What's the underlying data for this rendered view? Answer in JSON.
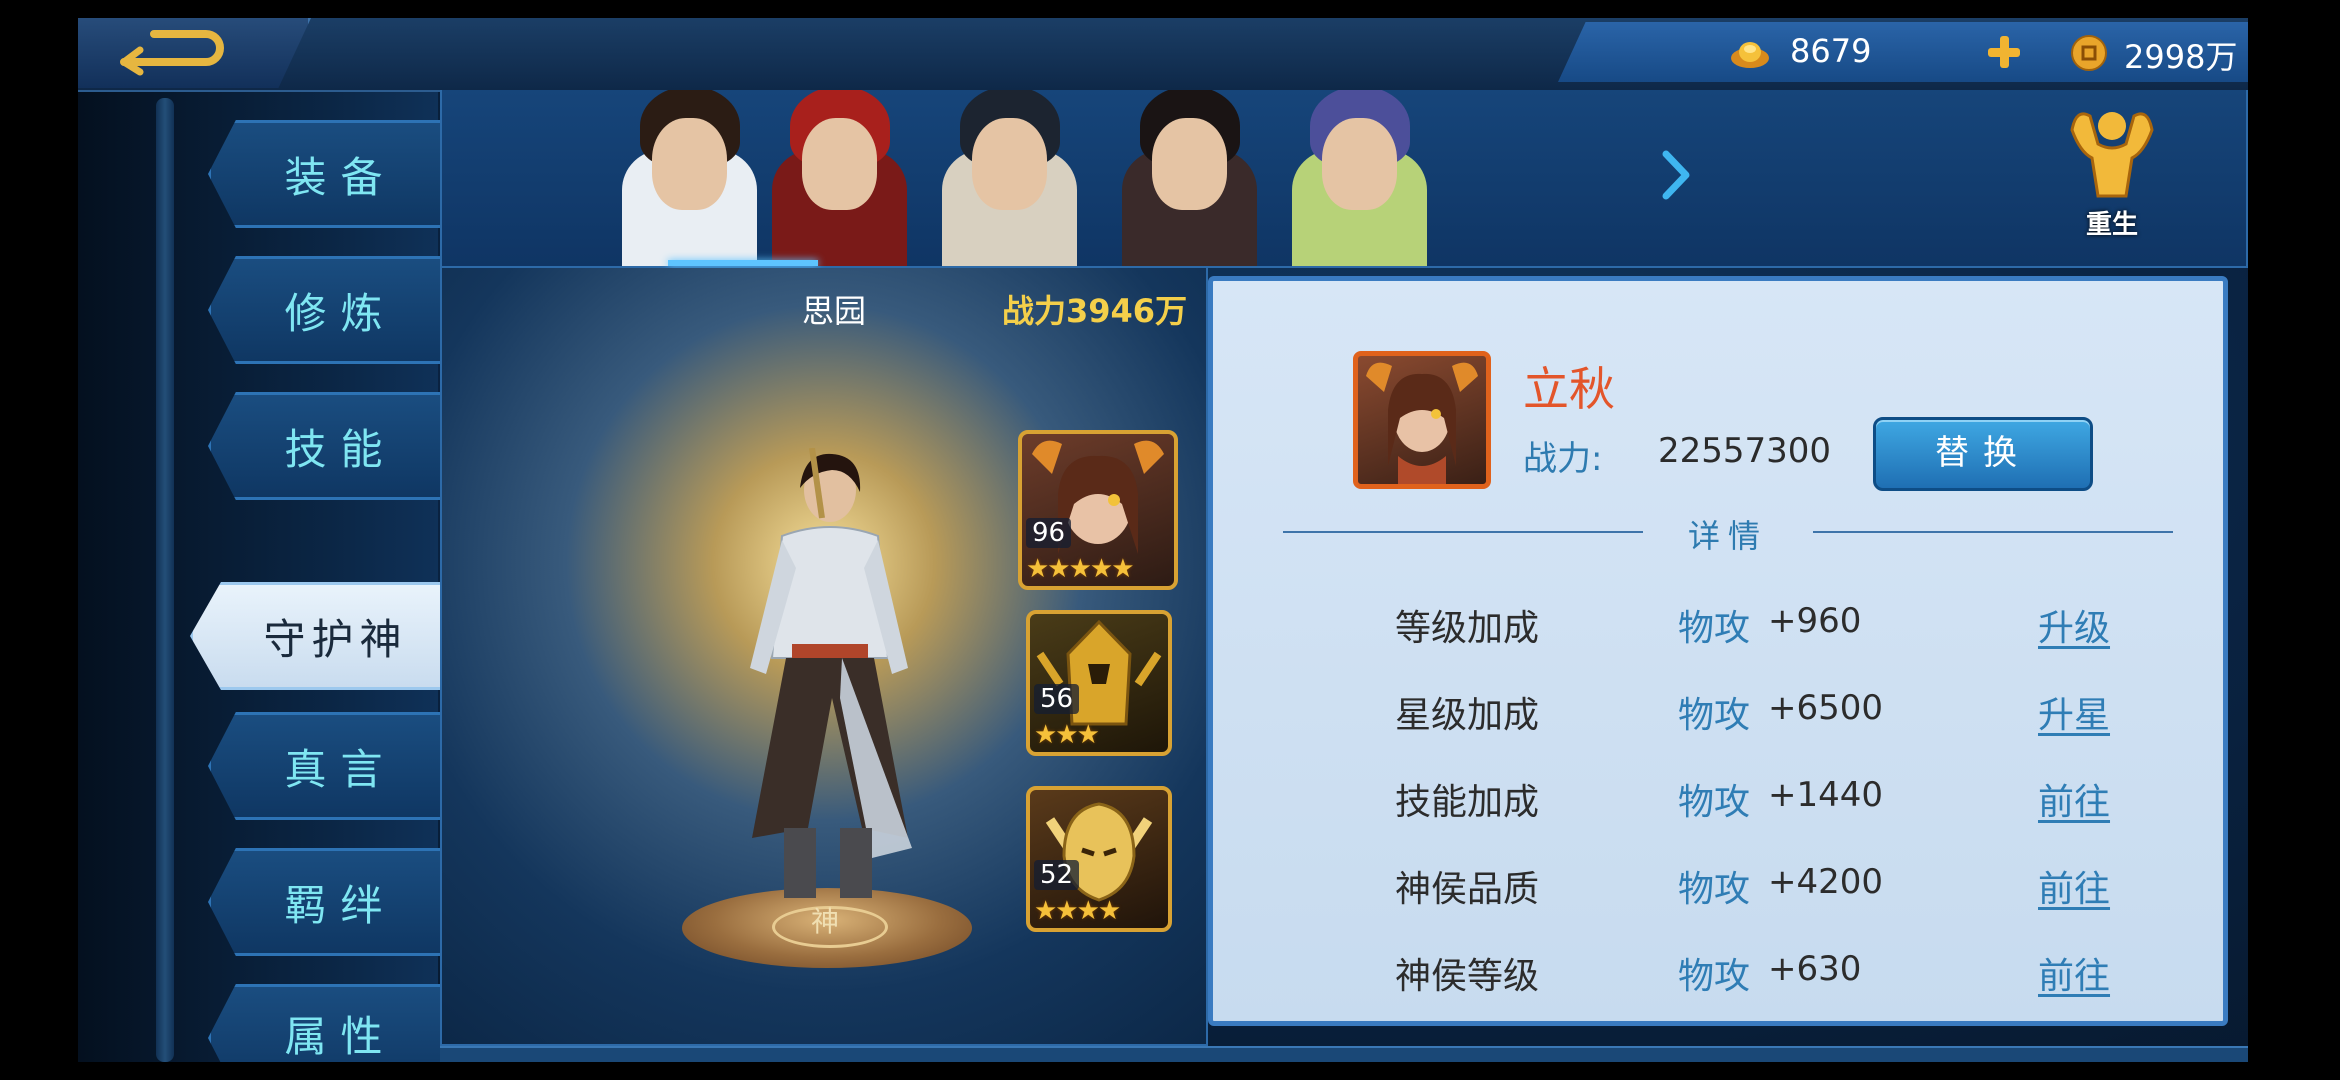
{
  "currency": {
    "ingot_value": "8679",
    "coin_value": "2998万"
  },
  "menu": {
    "items": [
      {
        "label": "装备",
        "active": false
      },
      {
        "label": "修炼",
        "active": false
      },
      {
        "label": "技能",
        "active": false
      },
      {
        "label": "守护神",
        "active": true
      },
      {
        "label": "真言",
        "active": false
      },
      {
        "label": "羁绊",
        "active": false
      },
      {
        "label": "属性",
        "active": false
      }
    ]
  },
  "hero_strip": {
    "rebirth_label": "重生"
  },
  "character": {
    "name": "思园",
    "power": "战力3946万"
  },
  "guardians": [
    {
      "level": "96",
      "stars": "★★★★★"
    },
    {
      "level": "56",
      "stars": "★★★"
    },
    {
      "level": "52",
      "stars": "★★★★"
    }
  ],
  "detail": {
    "guardian_name": "立秋",
    "power_label": "战力:",
    "power_value": "22557300",
    "replace_label": "替换",
    "section_title": "详情",
    "rows": [
      {
        "label": "等级加成",
        "type": "物攻",
        "value": "+960",
        "action": "升级"
      },
      {
        "label": "星级加成",
        "type": "物攻",
        "value": "+6500",
        "action": "升星"
      },
      {
        "label": "技能加成",
        "type": "物攻",
        "value": "+1440",
        "action": "前往"
      },
      {
        "label": "神侯品质",
        "type": "物攻",
        "value": "+4200",
        "action": "前往"
      },
      {
        "label": "神侯等级",
        "type": "物攻",
        "value": "+630",
        "action": "前往"
      }
    ]
  },
  "pedestal_glyph": "神",
  "colors": {
    "accent_gold": "#f4cf4a",
    "menu_text": "#7fe6f2",
    "link_blue": "#2f7db5",
    "guardian_name": "#e3552a"
  }
}
